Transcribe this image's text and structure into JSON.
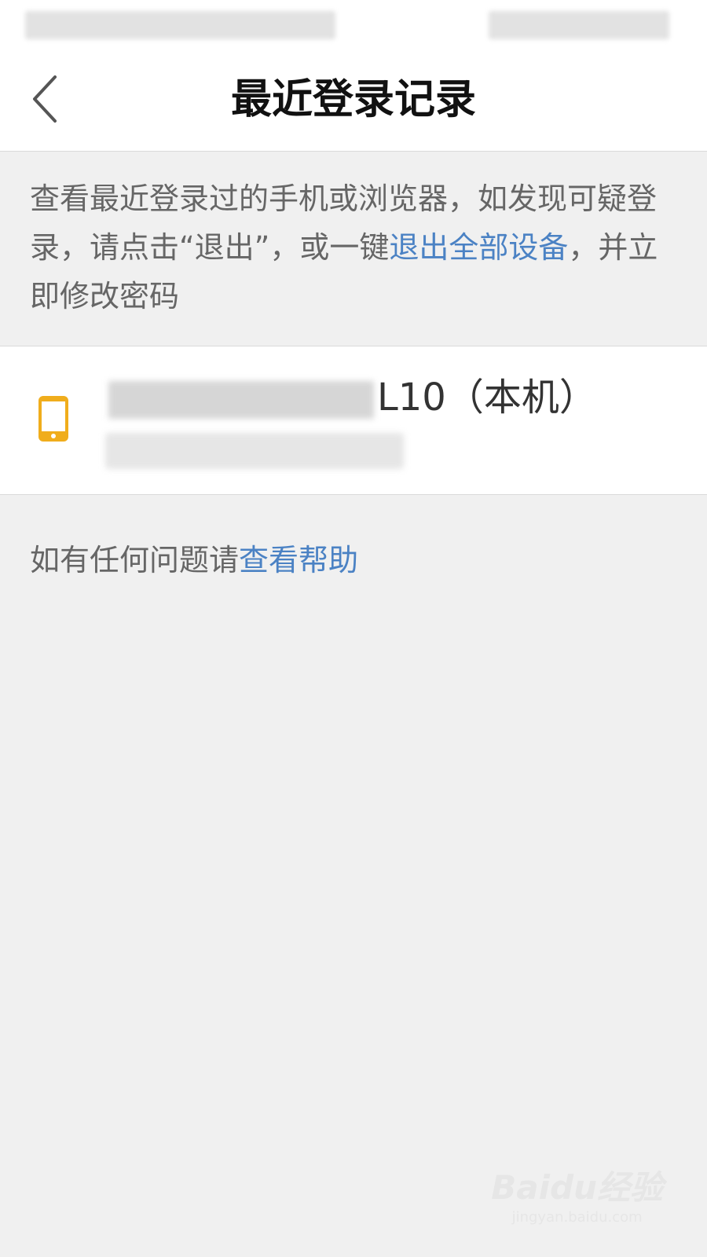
{
  "header": {
    "title": "最近登录记录",
    "back_icon": "chevron-left-icon"
  },
  "notice": {
    "text_before": "查看最近登录过的手机或浏览器，如发现可疑登录，请点击“退出”，或一键",
    "link_text": "退出全部设备",
    "text_after": "，并立即修改密码"
  },
  "device": {
    "icon": "phone-icon",
    "name_suffix": "L10（本机）",
    "icon_color": "#f0ad1c"
  },
  "help": {
    "text": "如有任何问题请",
    "link_text": "查看帮助"
  },
  "watermark": {
    "logo": "Baidu经验",
    "url": "jingyan.baidu.com"
  },
  "colors": {
    "link": "#4b82c4",
    "background": "#f0f0f0"
  }
}
